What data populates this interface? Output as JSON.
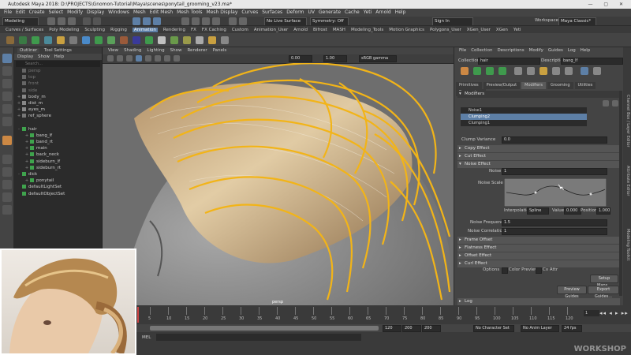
{
  "title": "Autodesk Maya 2018: D:\\PROJECTS\\Gnomon-Tutorial\\Maya\\scenes\\ponytail_grooming_v23.ma*",
  "menus": [
    "File",
    "Edit",
    "Create",
    "Select",
    "Modify",
    "Display",
    "Windows",
    "Mesh",
    "Edit Mesh",
    "Mesh Tools",
    "Mesh Display",
    "Curves",
    "Surfaces",
    "Deform",
    "UV",
    "Generate",
    "Cache",
    "Yeti",
    "Arnold",
    "Help"
  ],
  "status": {
    "mode": "Modeling",
    "live": "No Live Surface",
    "symmetry": "Symmetry: Off",
    "signin": "Sign In",
    "workspace_label": "Workspace :",
    "workspace_value": "Maya Classic*"
  },
  "shelf_tabs": [
    "Curves / Surfaces",
    "Poly Modeling",
    "Sculpting",
    "Rigging",
    "Animation",
    "Rendering",
    "FX",
    "FX Caching",
    "Custom",
    "Animation_User",
    "Arnold",
    "Bifrost",
    "MASH",
    "Modeling_Tools",
    "Motion Graphics",
    "Polygons_User",
    "XGen_User",
    "XGen",
    "Yeti"
  ],
  "outliner": {
    "title": "Outliner",
    "tool_settings": "Tool Settings",
    "menu": [
      "Display",
      "Show",
      "Help"
    ],
    "search": "Search...",
    "rows": [
      {
        "label": "persp",
        "indent": 0,
        "tw": "",
        "color": "#666"
      },
      {
        "label": "top",
        "indent": 0,
        "tw": "",
        "color": "#666"
      },
      {
        "label": "front",
        "indent": 0,
        "tw": "",
        "color": "#666"
      },
      {
        "label": "side",
        "indent": 0,
        "tw": "",
        "color": "#666"
      },
      {
        "label": "body_m",
        "indent": 0,
        "tw": "+",
        "color": "#888"
      },
      {
        "label": "dist_m",
        "indent": 0,
        "tw": "+",
        "color": "#888"
      },
      {
        "label": "eyes_m",
        "indent": 0,
        "tw": "+",
        "color": "#888"
      },
      {
        "label": "ref_sphere",
        "indent": 0,
        "tw": "+",
        "color": "#777"
      },
      {
        "label": "",
        "indent": 0,
        "tw": "",
        "color": "#2b2b2b"
      },
      {
        "label": "hair",
        "indent": 0,
        "tw": "-",
        "color": "#3fa34d"
      },
      {
        "label": "bang_lf",
        "indent": 1,
        "tw": "+",
        "color": "#3fa34d"
      },
      {
        "label": "band_rt",
        "indent": 1,
        "tw": "+",
        "color": "#3fa34d"
      },
      {
        "label": "main",
        "indent": 1,
        "tw": "+",
        "color": "#3fa34d"
      },
      {
        "label": "back_neck",
        "indent": 1,
        "tw": "+",
        "color": "#3fa34d"
      },
      {
        "label": "sideburn_lf",
        "indent": 1,
        "tw": "+",
        "color": "#3fa34d"
      },
      {
        "label": "sideburn_rt",
        "indent": 1,
        "tw": "+",
        "color": "#3fa34d"
      },
      {
        "label": "dick",
        "indent": 0,
        "tw": "-",
        "color": "#3fa34d"
      },
      {
        "label": "ponytail",
        "indent": 1,
        "tw": "+",
        "color": "#3fa34d"
      },
      {
        "label": "defaultLightSet",
        "indent": 0,
        "tw": "",
        "color": "#3fa34d"
      },
      {
        "label": "defaultObjectSet",
        "indent": 0,
        "tw": "",
        "color": "#3fa34d"
      }
    ]
  },
  "viewport": {
    "menu": [
      "View",
      "Shading",
      "Lighting",
      "Show",
      "Renderer",
      "Panels"
    ],
    "fields": {
      "a": "0.00",
      "b": "1.00",
      "colorspace": "sRGB gamma"
    },
    "camera_label": "persp"
  },
  "xgen": {
    "menu": [
      "File",
      "Collection",
      "Descriptions",
      "Modify",
      "Guides",
      "Log",
      "Help"
    ],
    "collection_label": "Collection",
    "collection_value": "hair",
    "description_label": "Description",
    "description_value": "bang_lf",
    "tabs": [
      "Primitives",
      "Preview/Output",
      "Modifiers",
      "Grooming",
      "Utilities",
      "Expressions"
    ],
    "active_tab": "Modifiers",
    "modifiers_label": "Modifiers",
    "modifier_list": [
      "Noise1",
      "Clumping2",
      "Clumping1"
    ],
    "clump_variance_label": "Clump Variance",
    "clump_variance_value": "0.0",
    "sections_collapsed": [
      "Copy Effect",
      "Cut Effect"
    ],
    "noise_effect": "Noise Effect",
    "noise_label": "Noise",
    "noise_value": "1",
    "noise_scale_label": "Noise Scale",
    "interpolation_label": "Interpolation:",
    "interpolation_value": "Spline",
    "value_label": "Value:",
    "value_value": "0.000",
    "position_label": "Position:",
    "position_value": "1.000",
    "noise_frequency_label": "Noise Frequency",
    "noise_frequency_value": "1.5",
    "noise_correlation_label": "Noise Correlation",
    "noise_correlation_value": "1",
    "sections_lower": [
      "Frame Offset",
      "Flatness Effect",
      "Offset Effect",
      "Curl Effect"
    ],
    "options_label": "Options",
    "color_preview": "Color Preview",
    "cv_attr": "Cv Attr",
    "setup_maps": "Setup Maps...",
    "preview_guides": "Preview Guides",
    "export_guides": "Export Guides...",
    "log_label": "Log"
  },
  "side_tabs": [
    "Channel Box / Layer Editor",
    "Attribute Editor",
    "Modeling Toolkit"
  ],
  "timeline": {
    "ticks": [
      "5",
      "10",
      "15",
      "20",
      "25",
      "30",
      "35",
      "40",
      "45",
      "50",
      "55",
      "60",
      "65",
      "70",
      "75",
      "80",
      "85",
      "90",
      "95",
      "100",
      "105",
      "110",
      "115",
      "120"
    ],
    "current": "1",
    "range_start": "1",
    "range_values": [
      "1",
      "120",
      "200",
      "200"
    ],
    "char_set": "No Character Set",
    "anim_layer": "No Anim Layer",
    "fps": "24 fps"
  },
  "command": {
    "lang": "MEL"
  },
  "watermark": "WORKSHOP",
  "colors": {
    "guide": "#f2b418",
    "highlight": "#5d7fa6",
    "hair": "#c9a676"
  }
}
